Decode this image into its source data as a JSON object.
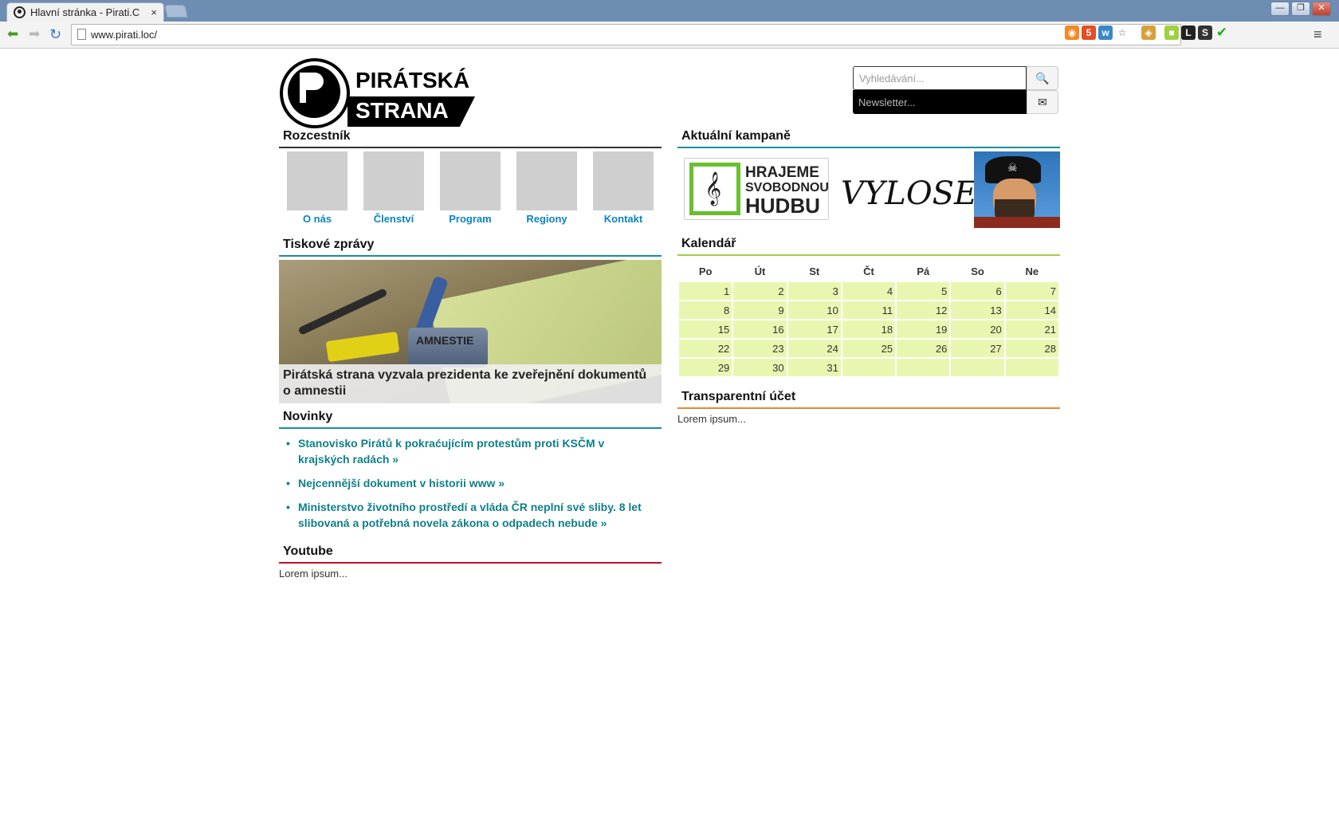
{
  "browser": {
    "tab_title": "Hlavní stránka - Pirati.C",
    "tab_close": "×",
    "url": "www.pirati.loc/",
    "window_controls": [
      "—",
      "❐",
      "✕"
    ],
    "extensions": [
      {
        "name": "rss-icon",
        "color": "#f08a24",
        "glyph": "◉"
      },
      {
        "name": "html5-icon",
        "color": "#e44d26",
        "glyph": "5"
      },
      {
        "name": "web-icon",
        "color": "#3a87c8",
        "glyph": "w"
      },
      {
        "name": "star-icon",
        "color": "#ffffff",
        "glyph": "☆"
      },
      {
        "name": "tool-icon",
        "color": "#d9a03a",
        "glyph": "◈"
      },
      {
        "name": "color-picker-icon",
        "color": "#a0d040",
        "glyph": "■"
      },
      {
        "name": "l-icon",
        "color": "#222222",
        "glyph": "L"
      },
      {
        "name": "s-icon",
        "color": "#333333",
        "glyph": "S"
      },
      {
        "name": "check-icon",
        "color": "#19b319",
        "glyph": "✔"
      }
    ],
    "menu_glyph": "≡"
  },
  "header": {
    "logo_line1": "PIRÁTSKÁ",
    "logo_line2": "STRANA",
    "search_placeholder": "Vyhledávání...",
    "newsletter_placeholder": "Newsletter...",
    "search_glyph": "🔍",
    "mail_glyph": "✉"
  },
  "rozcestnik": {
    "title": "Rozcestník",
    "bar_color": "#333333",
    "items": [
      "O nás",
      "Členství",
      "Program",
      "Regiony",
      "Kontakt"
    ]
  },
  "tiskove": {
    "title": "Tiskové zprávy",
    "bar_color": "#1a8e9a",
    "stamp_text": "AMNESTIE",
    "caption": "Pirátská strana vyzvala prezidenta ke zveřejnění dokumentů o amnestii"
  },
  "novinky": {
    "title": "Novinky",
    "bar_color": "#1a8e9a",
    "items": [
      "Stanovisko Pirátů k pokraćujícím protestům proti KSČM v krajských radách »",
      "Nejcennější dokument v historii www »",
      "Ministerstvo životního prostředí a vláda ČR neplní své sliby. 8 let slibovaná a potřebná novela zákona o odpadech nebude »"
    ]
  },
  "youtube": {
    "title": "Youtube",
    "bar_color": "#c8102e",
    "text": "Lorem ipsum..."
  },
  "kampane": {
    "title": "Aktuální kampaně",
    "bar_color": "#1a8e9a",
    "banner1_l1": "HRAJEME",
    "banner1_l2": "SVOBODNOU",
    "banner1_l3": "HUDBU",
    "banner2": "VYLOSENÍ",
    "skull": "☠"
  },
  "kalendar": {
    "title": "Kalendář",
    "bar_color": "#a3c94a",
    "days": [
      "Po",
      "Út",
      "St",
      "Čt",
      "Pá",
      "So",
      "Ne"
    ],
    "weeks": [
      [
        "1",
        "2",
        "3",
        "4",
        "5",
        "6",
        "7"
      ],
      [
        "8",
        "9",
        "10",
        "11",
        "12",
        "13",
        "14"
      ],
      [
        "15",
        "16",
        "17",
        "18",
        "19",
        "20",
        "21"
      ],
      [
        "22",
        "23",
        "24",
        "25",
        "26",
        "27",
        "28"
      ],
      [
        "29",
        "30",
        "31",
        "",
        "",
        "",
        ""
      ]
    ]
  },
  "ucet": {
    "title": "Transparentní účet",
    "bar_color": "#e8892f",
    "text": "Lorem ipsum..."
  }
}
